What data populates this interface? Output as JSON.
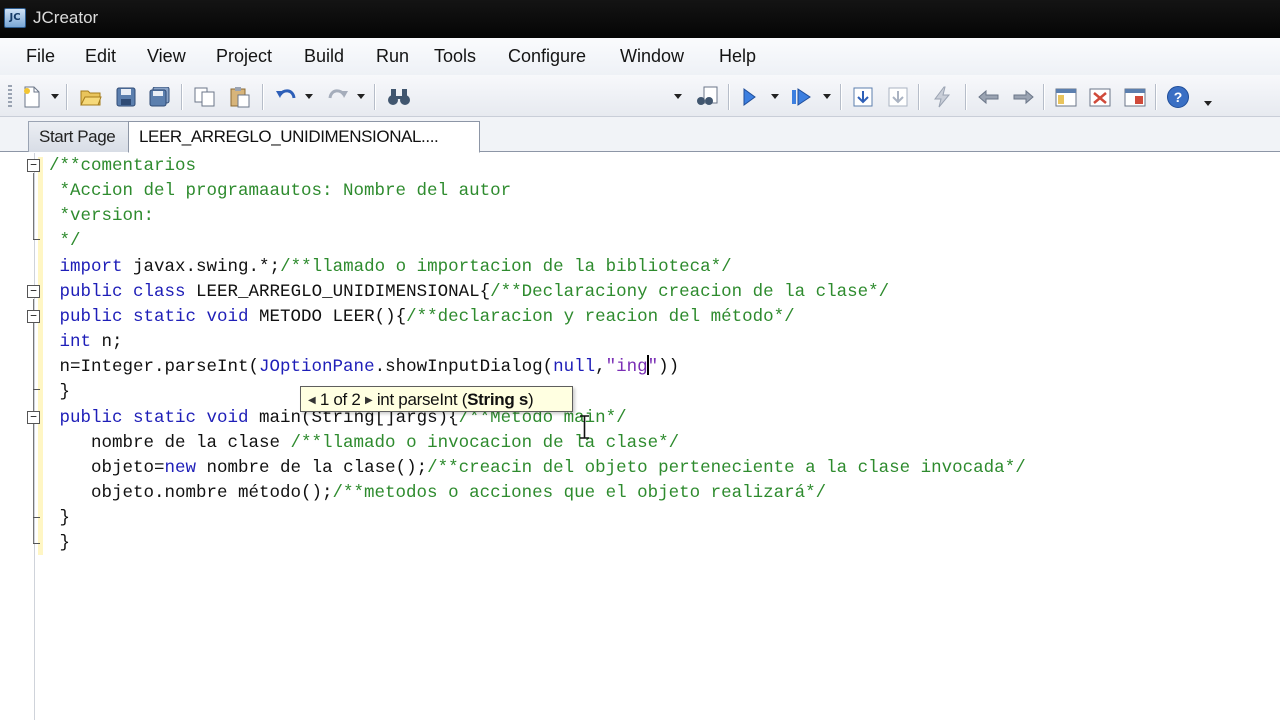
{
  "window": {
    "title": "JCreator",
    "app_icon": "jcreator-logo-icon"
  },
  "menu": [
    {
      "label": "File"
    },
    {
      "label": "Edit"
    },
    {
      "label": "View"
    },
    {
      "label": "Project"
    },
    {
      "label": "Build"
    },
    {
      "label": "Run"
    },
    {
      "label": "Tools"
    },
    {
      "label": "Configure"
    },
    {
      "label": "Window"
    },
    {
      "label": "Help"
    }
  ],
  "toolbar": {
    "icons": [
      "new-file-icon",
      "open-folder-icon",
      "save-icon",
      "save-all-icon",
      "copy-icon",
      "paste-icon",
      "undo-icon",
      "redo-icon",
      "find-icon",
      "find-in-files-icon",
      "run-icon",
      "execute-icon",
      "step-into-icon",
      "step-out-icon",
      "compile-icon",
      "back-icon",
      "forward-icon",
      "workspace-icon",
      "toggle-panel-icon",
      "options-icon",
      "help-icon"
    ]
  },
  "tabs": [
    {
      "label": "Start Page",
      "active": false
    },
    {
      "label": "LEER_ARREGLO_UNIDIMENSIONAL....",
      "active": true
    }
  ],
  "editor": {
    "lines": {
      "l1": "/**comentarios",
      "l2": " *Accion del programaautos: Nombre del autor",
      "l3": " *version:",
      "l4": " */",
      "l5_kw": "import",
      "l5_rest": " javax.swing.*;",
      "l5_comment": "/**llamado o importacion de la biblioteca*/",
      "l6_kw": "public class",
      "l6_rest": " LEER_ARREGLO_UNIDIMENSIONAL{",
      "l6_comment": "/**Declaraciony creacion de la clase*/",
      "l7_kw": "public static void",
      "l7_rest": " METODO LEER(){",
      "l7_comment": "/**declaracion y reacion del método*/",
      "l8_kw": "int",
      "l8_rest": " n;",
      "l9_pre": " n=Integer.parseInt(",
      "l9_obj": "JOptionPane",
      "l9_mid": ".showInputDialog(",
      "l9_null": "null",
      "l9_comma": ",",
      "l9_str": "\"ing",
      "l9_str_end": "\"",
      "l9_end": "))",
      "l10": " }",
      "l11_kw": "public static void",
      "l11_rest": " main(String[]args){",
      "l11_comment": "/**Metodo main*/",
      "l12_rest": "    nombre de la clase ",
      "l12_comment": "/**llamado o invocacion de la clase*/",
      "l13_pre": "    objeto=",
      "l13_kw": "new",
      "l13_rest": " nombre de la clase();",
      "l13_comment": "/**creacin del objeto perteneciente a la clase invocada*/",
      "l14_rest": "    objeto.nombre método();",
      "l14_comment": "/**metodos o acciones que el objeto realizará*/",
      "l15": " }",
      "l16": " }"
    }
  },
  "signature_tip": {
    "counter": "1 of 2",
    "signature_pre": "int parseInt (",
    "signature_bold": "String s",
    "signature_post": ")"
  }
}
